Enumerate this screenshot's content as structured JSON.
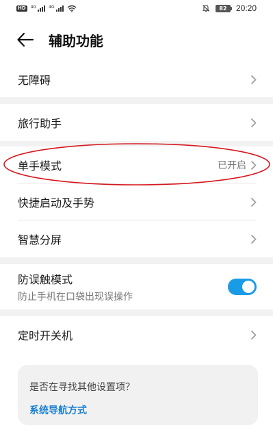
{
  "status_bar": {
    "hd": "HD",
    "net1": "4G",
    "net2": "4G",
    "battery": "82",
    "time": "20:20"
  },
  "header": {
    "title": "辅助功能"
  },
  "items": {
    "accessibility": {
      "label": "无障碍"
    },
    "travel": {
      "label": "旅行助手"
    },
    "one_hand": {
      "label": "单手模式",
      "status": "已开启"
    },
    "quick_start": {
      "label": "快捷启动及手势"
    },
    "smart_split": {
      "label": "智慧分屏"
    },
    "mistouch": {
      "label": "防误触模式",
      "sub": "防止手机在口袋出现误操作",
      "enabled": true
    },
    "timer_power": {
      "label": "定时开关机"
    }
  },
  "suggest": {
    "question": "是否在寻找其他设置项？",
    "link": "系统导航方式"
  },
  "colors": {
    "accent": "#1a9be6",
    "link": "#1a7fd1",
    "annotation": "#d6181e",
    "group_gap": "#f2f2f2"
  }
}
